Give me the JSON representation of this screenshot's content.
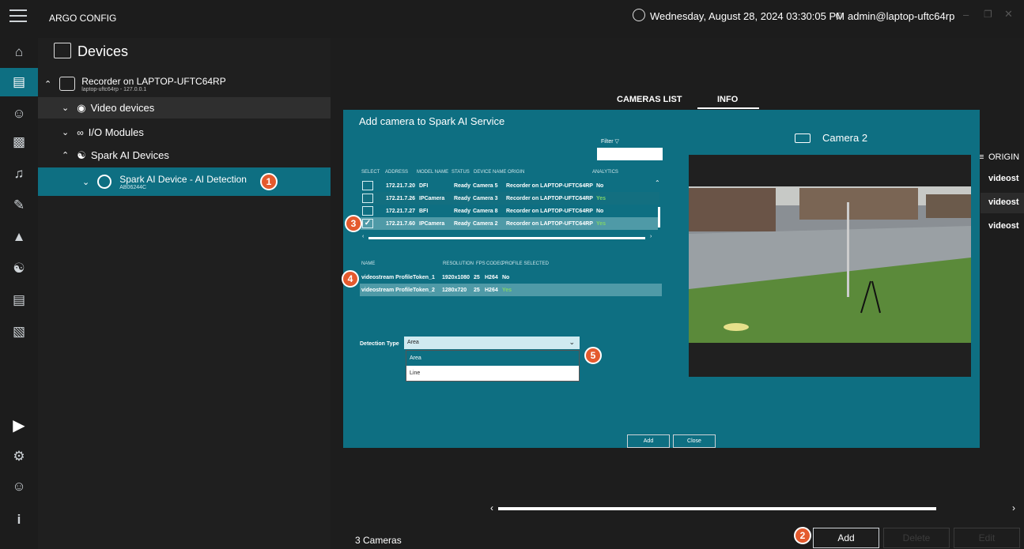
{
  "titlebar": {
    "app_title": "ARGO CONFIG",
    "datetime": "Wednesday, August 28, 2024 03:30:05 PM",
    "user": "admin@laptop-uftc64rp"
  },
  "header": {
    "title": "Devices"
  },
  "tree": {
    "recorder_name": "Recorder on LAPTOP-UFTC64RP",
    "recorder_sub": "laptop-uftc64rp - 127.0.0.1",
    "video_devices": "Video devices",
    "io_modules": "I/O Modules",
    "spark_ai_devices": "Spark AI Devices",
    "spark_device_name": "Spark AI Device - AI Detection",
    "spark_device_sub": "AB06244C"
  },
  "tabs": {
    "cameras_list": "CAMERAS LIST",
    "info": "INFO"
  },
  "dialog": {
    "title": "Add camera to Spark AI Service",
    "filter_label": "Filter",
    "camera_preview_label": "Camera 2",
    "camera_columns": [
      "SELECT",
      "ADDRESS",
      "MODEL NAME",
      "STATUS",
      "DEVICE NAME",
      "ORIGIN",
      "ANALYTICS"
    ],
    "cameras": [
      {
        "address": "172.21.7.20",
        "model": "DFI",
        "status": "Ready",
        "device": "Camera 5",
        "origin": "Recorder on LAPTOP-UFTC64RP",
        "analytics": "No",
        "checked": false
      },
      {
        "address": "172.21.7.26",
        "model": "IPCamera",
        "status": "Ready",
        "device": "Camera 3",
        "origin": "Recorder on LAPTOP-UFTC64RP",
        "analytics": "Yes",
        "checked": false
      },
      {
        "address": "172.21.7.27",
        "model": "BFI",
        "status": "Ready",
        "device": "Camera 8",
        "origin": "Recorder on LAPTOP-UFTC64RP",
        "analytics": "No",
        "checked": false
      },
      {
        "address": "172.21.7.60",
        "model": "IPCamera",
        "status": "Ready",
        "device": "Camera 2",
        "origin": "Recorder on LAPTOP-UFTC64RP",
        "analytics": "Yes",
        "checked": true
      }
    ],
    "profile_columns": [
      "NAME",
      "RESOLUTION",
      "FPS",
      "CODEC",
      "PROFILE SELECTED"
    ],
    "profiles": [
      {
        "name": "videostream ProfileToken_1",
        "resolution": "1920x1080",
        "fps": "25",
        "codec": "H264",
        "selected": "No"
      },
      {
        "name": "videostream ProfileToken_2",
        "resolution": "1280x720",
        "fps": "25",
        "codec": "H264",
        "selected": "Yes"
      }
    ],
    "detection_type_label": "Detection Type",
    "detection_type_value": "Area",
    "detection_options": [
      "Area",
      "Line"
    ],
    "add_button": "Add",
    "close_button": "Close"
  },
  "origin_column": {
    "header": "ORIGIN",
    "items": [
      "videost",
      "videost",
      "videost"
    ]
  },
  "footer": {
    "count": "3 Cameras",
    "add": "Add",
    "delete": "Delete",
    "edit": "Edit"
  },
  "badges": [
    "1",
    "2",
    "3",
    "4",
    "5"
  ],
  "colors": {
    "accent": "#0e6f82",
    "badge": "#e45a2e",
    "yes": "#7fd36b"
  }
}
